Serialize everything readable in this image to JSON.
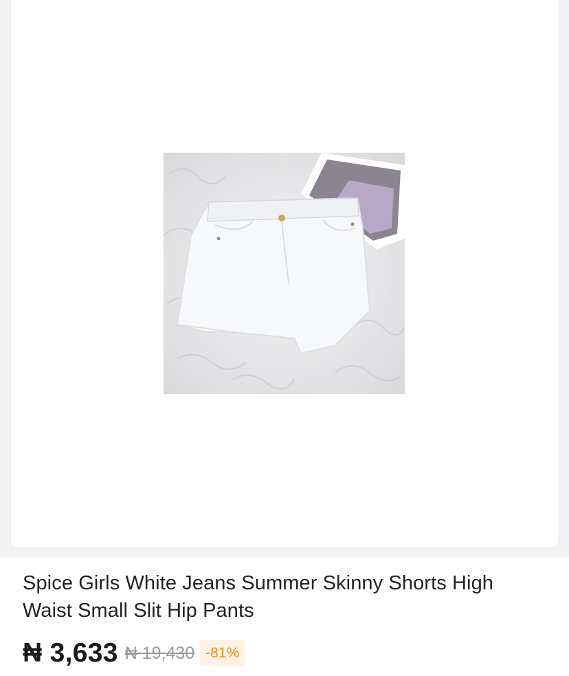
{
  "product": {
    "image_alt": "White high waist denim shorts on fur rug",
    "title": "Spice Girls White Jeans Summer Skinny Shorts High Waist Small Slit Hip Pants",
    "price_current": "₦ 3,633",
    "price_original": "₦ 19,430",
    "discount": "-81%"
  },
  "colors": {
    "page_background": "#f2f2f4",
    "price_text": "#1b1b1b",
    "original_price": "#9a9a9a",
    "discount_text": "#f08a1d",
    "discount_bg": "#fff1e4"
  }
}
